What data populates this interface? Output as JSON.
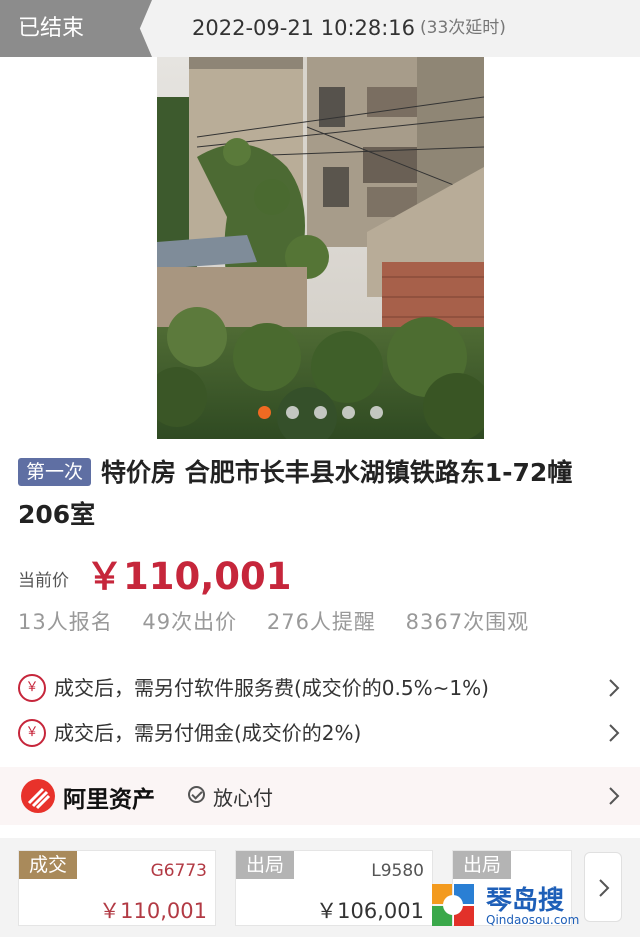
{
  "header": {
    "status": "已结束",
    "end_time": "2022-09-21 10:28:16",
    "delay": "(33次延时)"
  },
  "gallery": {
    "image_count": 5,
    "active_index": 0
  },
  "lot": {
    "badge": "第一次",
    "title": "特价房 合肥市长丰县水湖镇铁路东1-72幢206室",
    "price_label": "当前价",
    "price": "￥110,001"
  },
  "stats": [
    "13人报名",
    "49次出价",
    "276人提醒",
    "8367次围观"
  ],
  "notices": [
    {
      "icon": "yen-icon",
      "text": "成交后，需另付软件服务费(成交价的0.5%~1%)"
    },
    {
      "icon": "yen-icon",
      "text": "成交后，需另付佣金(成交价的2%)"
    }
  ],
  "platform": {
    "name": "阿里资产",
    "assurance": "放心付"
  },
  "bid_history": [
    {
      "status": "成交",
      "code": "G6773",
      "amount": "￥110,001"
    },
    {
      "status": "出局",
      "code": "L9580",
      "amount": "￥106,001"
    },
    {
      "status": "出局",
      "code": "",
      "amount": ""
    }
  ],
  "watermark": {
    "name": "琴岛搜",
    "url": "Qindaosou.com"
  },
  "colors": {
    "accent_red": "#c6263b",
    "badge_blue": "#5f6fa3",
    "deal_tag": "#a98a5b",
    "out_tag": "#b4b4b4",
    "active_dot": "#f06a22"
  }
}
